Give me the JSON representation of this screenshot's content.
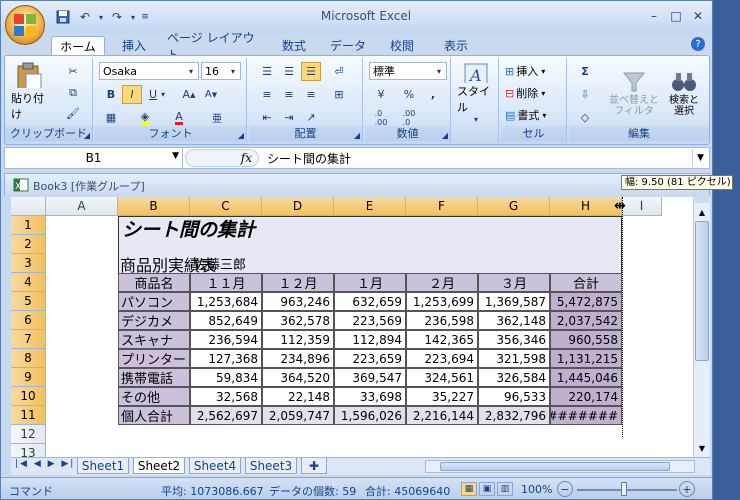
{
  "window": {
    "title": "Microsoft Excel"
  },
  "ribbon_tabs": [
    "ホーム",
    "挿入",
    "ページ レイアウト",
    "数式",
    "データ",
    "校閲",
    "表示"
  ],
  "ribbon": {
    "clipboard": {
      "label": "クリップボード",
      "paste": "貼り付け"
    },
    "font": {
      "label": "フォント",
      "name": "Osaka",
      "size": "16"
    },
    "alignment": {
      "label": "配置"
    },
    "number": {
      "label": "数値",
      "format": "標準"
    },
    "styles": {
      "label": "スタイル"
    },
    "cells": {
      "label": "セル",
      "insert": "挿入",
      "delete": "削除",
      "format": "書式"
    },
    "editing": {
      "label": "編集",
      "sort": "並べ替えと\nフィルタ",
      "find": "検索と\n選択"
    }
  },
  "formula_bar": {
    "name_box": "B1",
    "fx": "fx",
    "formula": "シート間の集計"
  },
  "workbook": {
    "title": "Book3 [作業グループ]"
  },
  "tooltip": "幅: 9.50 (81 ピクセル)",
  "grid": {
    "columns": [
      "A",
      "B",
      "C",
      "D",
      "E",
      "F",
      "G",
      "H",
      "I"
    ],
    "rows": [
      "1",
      "2",
      "3",
      "4",
      "5",
      "6",
      "7",
      "8",
      "9",
      "10",
      "11",
      "12",
      "13"
    ],
    "title": "シート間の集計",
    "subtitle": "商品別実績表",
    "author": "佐藤三郎",
    "headers": [
      "商品名",
      "１１月",
      "１２月",
      "１月",
      "２月",
      "３月",
      "合計"
    ],
    "data": [
      [
        "パソコン",
        "1,253,684",
        "963,246",
        "632,659",
        "1,253,699",
        "1,369,587",
        "5,472,875"
      ],
      [
        "デジカメ",
        "852,649",
        "362,578",
        "223,569",
        "236,598",
        "362,148",
        "2,037,542"
      ],
      [
        "スキャナ",
        "236,594",
        "112,359",
        "112,894",
        "142,365",
        "356,346",
        "960,558"
      ],
      [
        "プリンター",
        "127,368",
        "234,896",
        "223,659",
        "223,694",
        "321,598",
        "1,131,215"
      ],
      [
        "携帯電話",
        "59,834",
        "364,520",
        "369,547",
        "324,561",
        "326,584",
        "1,445,046"
      ],
      [
        "その他",
        "32,568",
        "22,148",
        "33,698",
        "35,227",
        "96,533",
        "220,174"
      ],
      [
        "個人合計",
        "2,562,697",
        "2,059,747",
        "1,596,026",
        "2,216,144",
        "2,832,796",
        "########"
      ]
    ]
  },
  "sheets": [
    "Sheet1",
    "Sheet2",
    "Sheet4",
    "Sheet3"
  ],
  "status": {
    "mode": "コマンド",
    "average": "平均: 1073086.667",
    "count": "データの個数: 59",
    "sum": "合計: 45069640",
    "zoom": "100%"
  },
  "colors": {
    "accent": "#15428b",
    "selected_header": "#f1c15f",
    "header_fill": "#ccc0da",
    "total_fill": "#bfb0cf"
  }
}
